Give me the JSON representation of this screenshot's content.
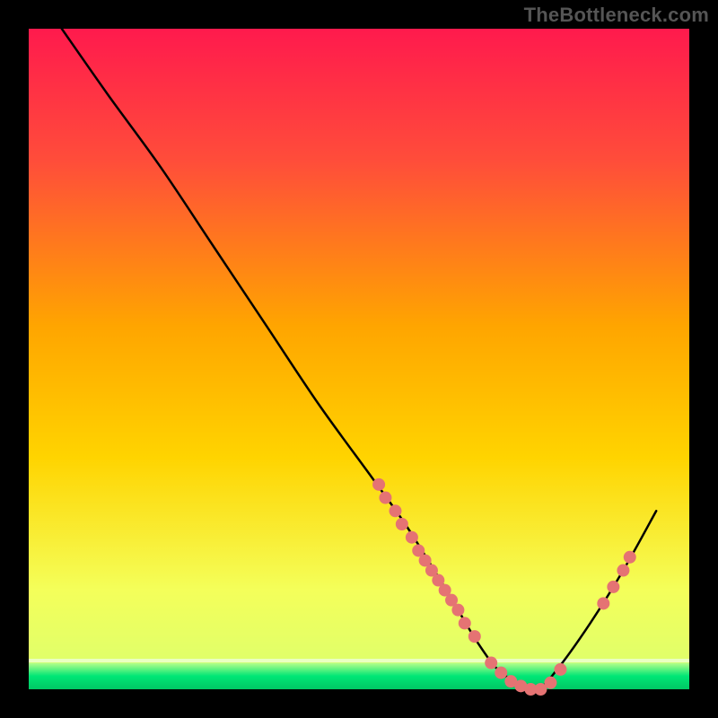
{
  "watermark": "TheBottleneck.com",
  "chart_data": {
    "type": "line",
    "title": "",
    "xlabel": "",
    "ylabel": "",
    "xlim": [
      0,
      100
    ],
    "ylim": [
      0,
      100
    ],
    "grid": false,
    "legend": false,
    "background_gradient": {
      "top": "#ff1a4d",
      "mid": "#ffd400",
      "bottom": "#00e676"
    },
    "green_band": {
      "y_start": 0,
      "y_end": 4
    },
    "series": [
      {
        "name": "bottleneck-curve",
        "color": "#000000",
        "x": [
          5,
          12,
          20,
          28,
          36,
          44,
          52,
          57,
          62,
          65,
          68,
          71,
          74,
          77,
          80,
          85,
          90,
          95
        ],
        "y": [
          100,
          90,
          79,
          67,
          55,
          43,
          32,
          25,
          17,
          12,
          7,
          3,
          1,
          0,
          3,
          10,
          18,
          27
        ]
      }
    ],
    "points": {
      "name": "marker-dots",
      "color": "#e57373",
      "radius": 7,
      "coords": [
        {
          "x": 53,
          "y": 31
        },
        {
          "x": 54,
          "y": 29
        },
        {
          "x": 55.5,
          "y": 27
        },
        {
          "x": 56.5,
          "y": 25
        },
        {
          "x": 58,
          "y": 23
        },
        {
          "x": 59,
          "y": 21
        },
        {
          "x": 60,
          "y": 19.5
        },
        {
          "x": 61,
          "y": 18
        },
        {
          "x": 62,
          "y": 16.5
        },
        {
          "x": 63,
          "y": 15
        },
        {
          "x": 64,
          "y": 13.5
        },
        {
          "x": 65,
          "y": 12
        },
        {
          "x": 66,
          "y": 10
        },
        {
          "x": 67.5,
          "y": 8
        },
        {
          "x": 70,
          "y": 4
        },
        {
          "x": 71.5,
          "y": 2.5
        },
        {
          "x": 73,
          "y": 1.2
        },
        {
          "x": 74.5,
          "y": 0.5
        },
        {
          "x": 76,
          "y": 0
        },
        {
          "x": 77.5,
          "y": 0
        },
        {
          "x": 79,
          "y": 1
        },
        {
          "x": 80.5,
          "y": 3
        },
        {
          "x": 87,
          "y": 13
        },
        {
          "x": 88.5,
          "y": 15.5
        },
        {
          "x": 90,
          "y": 18
        },
        {
          "x": 91,
          "y": 20
        }
      ]
    }
  }
}
